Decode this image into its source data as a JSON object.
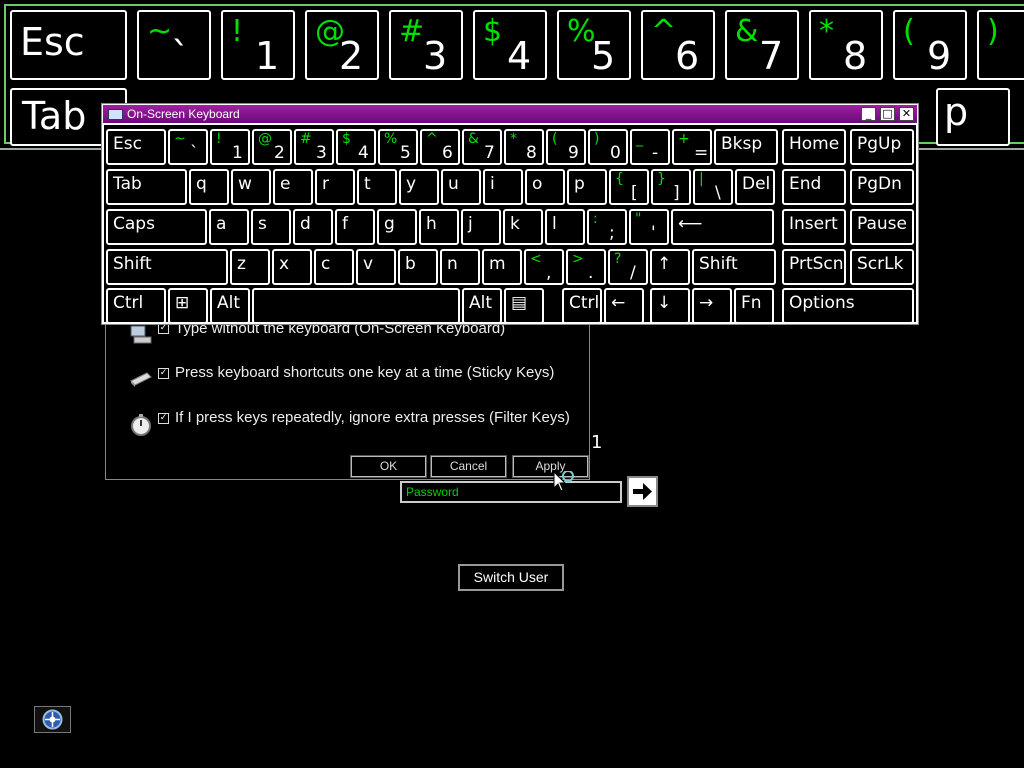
{
  "background_keyboard": {
    "row1": [
      {
        "main": "Esc",
        "shift": ""
      },
      {
        "main": "`",
        "shift": "~"
      },
      {
        "main": "1",
        "shift": "!"
      },
      {
        "main": "2",
        "shift": "@"
      },
      {
        "main": "3",
        "shift": "#"
      },
      {
        "main": "4",
        "shift": "$"
      },
      {
        "main": "5",
        "shift": "%"
      },
      {
        "main": "6",
        "shift": "^"
      },
      {
        "main": "7",
        "shift": "&"
      },
      {
        "main": "8",
        "shift": "*"
      },
      {
        "main": "9",
        "shift": "("
      },
      {
        "main": "",
        "shift": ")"
      }
    ],
    "row2": [
      {
        "main": "Tab",
        "shift": ""
      },
      {
        "main": "p",
        "shift": ""
      }
    ]
  },
  "osk": {
    "title": "On-Screen Keyboard",
    "title_buttons": {
      "minimize": "_",
      "maximize": "□",
      "close": "✕"
    },
    "rows": [
      [
        {
          "main": "Esc",
          "shift": ""
        },
        {
          "main": "`",
          "shift": "~"
        },
        {
          "main": "1",
          "shift": "!"
        },
        {
          "main": "2",
          "shift": "@"
        },
        {
          "main": "3",
          "shift": "#"
        },
        {
          "main": "4",
          "shift": "$"
        },
        {
          "main": "5",
          "shift": "%"
        },
        {
          "main": "6",
          "shift": "^"
        },
        {
          "main": "7",
          "shift": "&"
        },
        {
          "main": "8",
          "shift": "*"
        },
        {
          "main": "9",
          "shift": "("
        },
        {
          "main": "0",
          "shift": ")"
        },
        {
          "main": "-",
          "shift": "_"
        },
        {
          "main": "=",
          "shift": "+"
        },
        {
          "main": "Bksp",
          "shift": ""
        },
        {
          "main": "Home",
          "shift": ""
        },
        {
          "main": "PgUp",
          "shift": ""
        }
      ],
      [
        {
          "main": "Tab",
          "shift": ""
        },
        {
          "main": "q",
          "shift": ""
        },
        {
          "main": "w",
          "shift": ""
        },
        {
          "main": "e",
          "shift": ""
        },
        {
          "main": "r",
          "shift": ""
        },
        {
          "main": "t",
          "shift": ""
        },
        {
          "main": "y",
          "shift": ""
        },
        {
          "main": "u",
          "shift": ""
        },
        {
          "main": "i",
          "shift": ""
        },
        {
          "main": "o",
          "shift": ""
        },
        {
          "main": "p",
          "shift": ""
        },
        {
          "main": "[",
          "shift": "{"
        },
        {
          "main": "]",
          "shift": "}"
        },
        {
          "main": "\\",
          "shift": "|"
        },
        {
          "main": "Del",
          "shift": ""
        },
        {
          "main": "End",
          "shift": ""
        },
        {
          "main": "PgDn",
          "shift": ""
        }
      ],
      [
        {
          "main": "Caps",
          "shift": ""
        },
        {
          "main": "a",
          "shift": ""
        },
        {
          "main": "s",
          "shift": ""
        },
        {
          "main": "d",
          "shift": ""
        },
        {
          "main": "f",
          "shift": ""
        },
        {
          "main": "g",
          "shift": ""
        },
        {
          "main": "h",
          "shift": ""
        },
        {
          "main": "j",
          "shift": ""
        },
        {
          "main": "k",
          "shift": ""
        },
        {
          "main": "l",
          "shift": ""
        },
        {
          "main": ";",
          "shift": ":"
        },
        {
          "main": "'",
          "shift": "\""
        },
        {
          "main": "⟵",
          "shift": ""
        },
        {
          "main": "Insert",
          "shift": ""
        },
        {
          "main": "Pause",
          "shift": ""
        }
      ],
      [
        {
          "main": "Shift",
          "shift": ""
        },
        {
          "main": "z",
          "shift": ""
        },
        {
          "main": "x",
          "shift": ""
        },
        {
          "main": "c",
          "shift": ""
        },
        {
          "main": "v",
          "shift": ""
        },
        {
          "main": "b",
          "shift": ""
        },
        {
          "main": "n",
          "shift": ""
        },
        {
          "main": "m",
          "shift": ""
        },
        {
          "main": ",",
          "shift": "<"
        },
        {
          "main": ".",
          "shift": ">"
        },
        {
          "main": "/",
          "shift": "?"
        },
        {
          "main": "↑",
          "shift": ""
        },
        {
          "main": "Shift",
          "shift": ""
        },
        {
          "main": "PrtScn",
          "shift": ""
        },
        {
          "main": "ScrLk",
          "shift": ""
        }
      ],
      [
        {
          "main": "Ctrl",
          "shift": ""
        },
        {
          "main": "⊞",
          "shift": ""
        },
        {
          "main": "Alt",
          "shift": ""
        },
        {
          "main": "",
          "shift": ""
        },
        {
          "main": "Alt",
          "shift": ""
        },
        {
          "main": "▤",
          "shift": ""
        },
        {
          "main": "Ctrl",
          "shift": ""
        },
        {
          "main": "←",
          "shift": ""
        },
        {
          "main": "↓",
          "shift": ""
        },
        {
          "main": "→",
          "shift": ""
        },
        {
          "main": "Fn",
          "shift": ""
        },
        {
          "main": "Options",
          "shift": ""
        }
      ]
    ]
  },
  "dialog": {
    "options": [
      {
        "label": "Type without the keyboard (On-Screen Keyboard)",
        "checked": true,
        "icon": "keyboard-monitor-icon"
      },
      {
        "label": "Press keyboard shortcuts one key at a time (Sticky Keys)",
        "checked": true,
        "icon": "sticky-keys-icon"
      },
      {
        "label": "If I press keys repeatedly, ignore extra presses (Filter Keys)",
        "checked": true,
        "icon": "stopwatch-icon"
      }
    ],
    "buttons": {
      "ok": "OK",
      "cancel": "Cancel",
      "apply": "Apply"
    }
  },
  "badge": "1",
  "login": {
    "password_placeholder": "Password",
    "submit_icon": "arrow-right-icon",
    "switch_user": "Switch User"
  },
  "ease_of_access_icon": "ease-of-access-icon"
}
